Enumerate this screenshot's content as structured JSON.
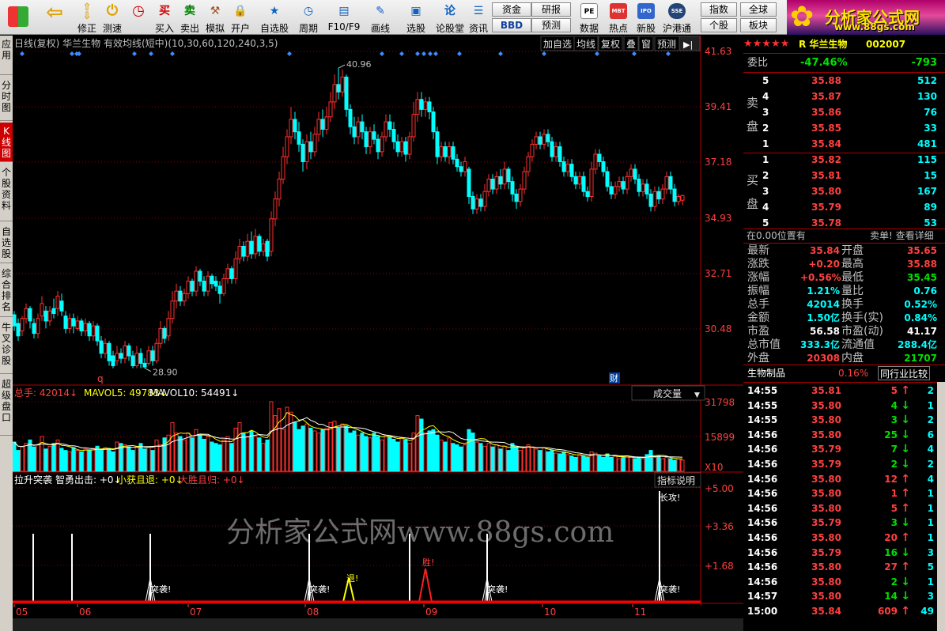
{
  "toolbar": {
    "items": [
      {
        "label": "买入",
        "icon": "buy-icon",
        "glyph": "买",
        "color": "#d00000"
      },
      {
        "label": "卖出",
        "icon": "sell-icon",
        "glyph": "卖",
        "color": "#008000"
      },
      {
        "label": "模拟",
        "icon": "gavel-icon",
        "glyph": "⚒",
        "color": "#a05020"
      },
      {
        "label": "开户",
        "icon": "lock-icon",
        "glyph": "🔒",
        "color": "#606060"
      },
      {
        "label": "自选股",
        "icon": "star-folder-icon",
        "glyph": "★",
        "color": "#1060c0"
      },
      {
        "label": "周期",
        "icon": "clock-icon",
        "glyph": "◷",
        "color": "#1060c0"
      },
      {
        "label": "F10/F9",
        "icon": "document-icon",
        "glyph": "▤",
        "color": "#1060c0"
      },
      {
        "label": "画线",
        "icon": "pen-icon",
        "glyph": "✎",
        "color": "#1060c0"
      },
      {
        "label": "选股",
        "icon": "screen-icon",
        "glyph": "▣",
        "color": "#1060c0"
      },
      {
        "label": "论股堂",
        "icon": "discuss-icon",
        "glyph": "论",
        "color": "#1060c0"
      },
      {
        "label": "资讯",
        "icon": "news-icon",
        "glyph": "☰",
        "color": "#1060c0"
      }
    ],
    "nav": {
      "back": "back-arrow-icon",
      "fix": "修正",
      "test": "测速"
    },
    "buttons": {
      "zijin": "资金",
      "yanbao": "研报",
      "bbd": "BBD",
      "yuce": "预测",
      "shuju": "数据",
      "redian": "热点",
      "xingu": "新股",
      "hugangtong": "沪港通",
      "zhishu": "指数",
      "quanqiu": "全球",
      "gegu": "个股",
      "bankuai": "板块"
    },
    "pe": "PE",
    "mbt": "MBT",
    "ipo": "IPO",
    "sse": "SSE"
  },
  "logo": {
    "title": "分析家公式网",
    "url": "www.88gs.com"
  },
  "left_tabs": [
    "应用",
    "分时图",
    "K线图",
    "个股资料",
    "自选股",
    "综合排名",
    "牛叉诊股",
    "超级盘口"
  ],
  "chart": {
    "header": "日线(复权) 华兰生物 有效均线(短中)(10,30,60,120,240,3,5)",
    "header_buttons": [
      "加自选",
      "均线",
      "复权",
      "叠",
      "窗",
      "预测"
    ],
    "price_axis": [
      "41.63",
      "39.41",
      "37.18",
      "34.93",
      "32.71",
      "30.48"
    ],
    "high_label": "40.96",
    "low_label": "28.90",
    "marker_q": "q",
    "marker_cai": "财",
    "volume_header": {
      "zongshou": "总手: 42014",
      "ma5": "MAVOL5: 49783",
      "ma10": "MAVOL10: 54491"
    },
    "volume_selector": "成交量",
    "volume_axis": [
      "31798",
      "15899",
      "X10"
    ],
    "indicator_header": {
      "name": "拉升突袭",
      "a": "智勇出击: +0",
      "b": "小获且退: +0",
      "c": "大胜且归: +0"
    },
    "indicator_help": "指标说明",
    "indicator_axis": [
      "+5.00",
      "+3.36",
      "+1.68"
    ],
    "signals": {
      "tuxi": "突袭!",
      "tui": "退!",
      "sheng": "胜!",
      "zhanggong": "长攻!"
    },
    "watermark": "分析家公式网www.88gs.com",
    "months": [
      "05",
      "06",
      "07",
      "08",
      "09",
      "10",
      "11"
    ]
  },
  "quote": {
    "stars": "★★★★★",
    "code_prefix": "R 华兰生物",
    "code": "002007",
    "weibi_label": "委比",
    "weibi": "-47.46%",
    "weicha": "-793",
    "sell_label": "卖盘",
    "buy_label": "买盘",
    "asks": [
      {
        "lv": "5",
        "p": "35.88",
        "v": "512"
      },
      {
        "lv": "4",
        "p": "35.87",
        "v": "130"
      },
      {
        "lv": "3",
        "p": "35.86",
        "v": "76"
      },
      {
        "lv": "2",
        "p": "35.85",
        "v": "33"
      },
      {
        "lv": "1",
        "p": "35.84",
        "v": "481"
      }
    ],
    "bids": [
      {
        "lv": "1",
        "p": "35.82",
        "v": "115"
      },
      {
        "lv": "2",
        "p": "35.81",
        "v": "15"
      },
      {
        "lv": "3",
        "p": "35.80",
        "v": "167"
      },
      {
        "lv": "4",
        "p": "35.79",
        "v": "89"
      },
      {
        "lv": "5",
        "p": "35.78",
        "v": "53"
      }
    ],
    "position_text": "在0.00位置有",
    "detail_text": "卖单! 查看详细",
    "stats": [
      [
        "最新",
        "35.84",
        "red",
        "开盘",
        "35.65",
        "red"
      ],
      [
        "涨跌",
        "+0.20",
        "red",
        "最高",
        "35.88",
        "red"
      ],
      [
        "涨幅",
        "+0.56%",
        "red",
        "最低",
        "35.45",
        "grn"
      ],
      [
        "振幅",
        "1.21%",
        "cyan",
        "量比",
        "0.76",
        "cyan"
      ],
      [
        "总手",
        "42014",
        "cyan",
        "换手",
        "0.52%",
        "cyan"
      ],
      [
        "金额",
        "1.50亿",
        "cyan",
        "换手(实)",
        "0.84%",
        "cyan"
      ],
      [
        "市盈",
        "56.58",
        "wht",
        "市盈(动)",
        "41.17",
        "wht"
      ],
      [
        "总市值",
        "333.3亿",
        "cyan",
        "流通值",
        "288.4亿",
        "cyan"
      ],
      [
        "外盘",
        "20308",
        "red",
        "内盘",
        "21707",
        "grn"
      ]
    ],
    "sector": "生物制品",
    "sector_pct": "0.16%",
    "compare": "同行业比较",
    "ticks": [
      [
        "14:55",
        "35.81",
        "red",
        "5",
        "up",
        "2"
      ],
      [
        "14:55",
        "35.80",
        "red",
        "4",
        "dn",
        "1"
      ],
      [
        "14:55",
        "35.80",
        "red",
        "3",
        "dn",
        "2"
      ],
      [
        "14:56",
        "35.80",
        "red",
        "25",
        "dn",
        "6"
      ],
      [
        "14:56",
        "35.79",
        "red",
        "7",
        "dn",
        "4"
      ],
      [
        "14:56",
        "35.79",
        "red",
        "2",
        "dn",
        "2"
      ],
      [
        "14:56",
        "35.80",
        "red",
        "12",
        "up",
        "4"
      ],
      [
        "14:56",
        "35.80",
        "red",
        "1",
        "up",
        "1"
      ],
      [
        "14:56",
        "35.80",
        "red",
        "5",
        "up",
        "1"
      ],
      [
        "14:56",
        "35.79",
        "red",
        "3",
        "dn",
        "1"
      ],
      [
        "14:56",
        "35.80",
        "red",
        "20",
        "up",
        "1"
      ],
      [
        "14:56",
        "35.79",
        "red",
        "16",
        "dn",
        "3"
      ],
      [
        "14:56",
        "35.80",
        "red",
        "27",
        "up",
        "5"
      ],
      [
        "14:56",
        "35.80",
        "red",
        "2",
        "dn",
        "1"
      ],
      [
        "14:57",
        "35.80",
        "red",
        "14",
        "dn",
        "3"
      ],
      [
        "15:00",
        "35.84",
        "red",
        "609",
        "up",
        "49"
      ]
    ]
  }
}
